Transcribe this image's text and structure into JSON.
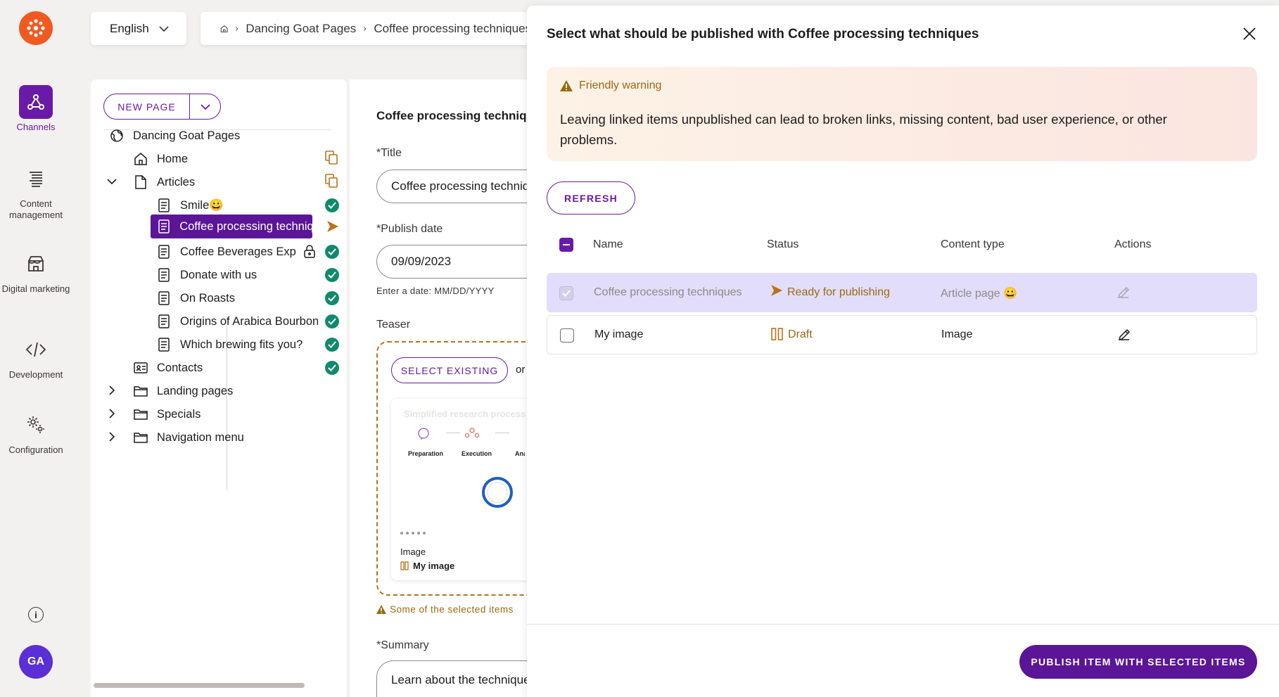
{
  "nav": {
    "items": [
      {
        "label": "Channels",
        "icon": "channels-icon",
        "active": true
      },
      {
        "label": "Content management",
        "icon": "content-management-icon"
      },
      {
        "label": "Digital marketing",
        "icon": "digital-marketing-icon"
      },
      {
        "label": "Development",
        "icon": "development-icon"
      },
      {
        "label": "Configuration",
        "icon": "configuration-icon"
      }
    ],
    "info_symbol": "i",
    "avatar_initials": "GA"
  },
  "topbar": {
    "language": "English",
    "breadcrumb": [
      "Dancing Goat Pages",
      "Coffee processing techniques"
    ]
  },
  "tree": {
    "new_page_label": "NEW PAGE",
    "root": "Dancing Goat Pages",
    "items": [
      {
        "label": "Home",
        "icon": "page-icon",
        "status": "copy"
      },
      {
        "label": "Articles",
        "icon": "file-icon",
        "status": "copy",
        "expanded": true
      },
      {
        "label": "Smile😀",
        "icon": "document-icon",
        "status": "published"
      },
      {
        "label": "Coffee processing techniques",
        "icon": "document-icon",
        "status": "ready",
        "selected": true
      },
      {
        "label": "Coffee Beverages Explained",
        "icon": "document-icon",
        "status": "published",
        "locked": true
      },
      {
        "label": "Donate with us",
        "icon": "document-icon",
        "status": "published"
      },
      {
        "label": "On Roasts",
        "icon": "document-icon",
        "status": "published"
      },
      {
        "label": "Origins of Arabica Bourbon",
        "icon": "document-icon",
        "status": "published"
      },
      {
        "label": "Which brewing fits you?",
        "icon": "document-icon",
        "status": "published"
      },
      {
        "label": "Contacts",
        "icon": "contact-card-icon",
        "status": "published"
      },
      {
        "label": "Landing pages",
        "icon": "folder-icon",
        "collapsed": true
      },
      {
        "label": "Specials",
        "icon": "folder-icon",
        "collapsed": true
      },
      {
        "label": "Navigation menu",
        "icon": "folder-icon",
        "collapsed": true
      }
    ]
  },
  "form": {
    "heading": "Coffee processing techniques",
    "title_label": "*Title",
    "title_value": "Coffee processing techniques",
    "publish_date_label": "*Publish date",
    "publish_date_value": "09/09/2023",
    "date_hint": "Enter a date: MM/DD/YYYY",
    "teaser_label": "Teaser",
    "select_existing_label": "SELECT EXISTING",
    "or_text": "or",
    "card_image_title": "Simplified research process",
    "card_steps": [
      "Preparation",
      "Execution",
      "Analysis"
    ],
    "card_type": "Image",
    "card_name": "My image",
    "teaser_warning": "Some of the selected items",
    "summary_label": "*Summary",
    "summary_value": "Learn about the techniques"
  },
  "dialog": {
    "title": "Select what should be published with Coffee processing techniques",
    "warning_title": "Friendly warning",
    "warning_text": "Leaving linked items unpublished can lead to broken links, missing content, bad user experience, or other problems.",
    "refresh_label": "REFRESH",
    "columns": {
      "name": "Name",
      "status": "Status",
      "content_type": "Content type",
      "actions": "Actions"
    },
    "rows": [
      {
        "name": "Coffee processing techniques",
        "status": "Ready for publishing",
        "content_type": "Article page 😀",
        "checked": true,
        "disabled": true
      },
      {
        "name": "My image",
        "status": "Draft",
        "content_type": "Image",
        "checked": false
      }
    ],
    "publish_label": "PUBLISH ITEM WITH SELECTED ITEMS"
  },
  "colors": {
    "brand": "#6a1aa8",
    "accent": "#f05a22",
    "published": "#0f8a6c",
    "warning": "#b8741a"
  }
}
